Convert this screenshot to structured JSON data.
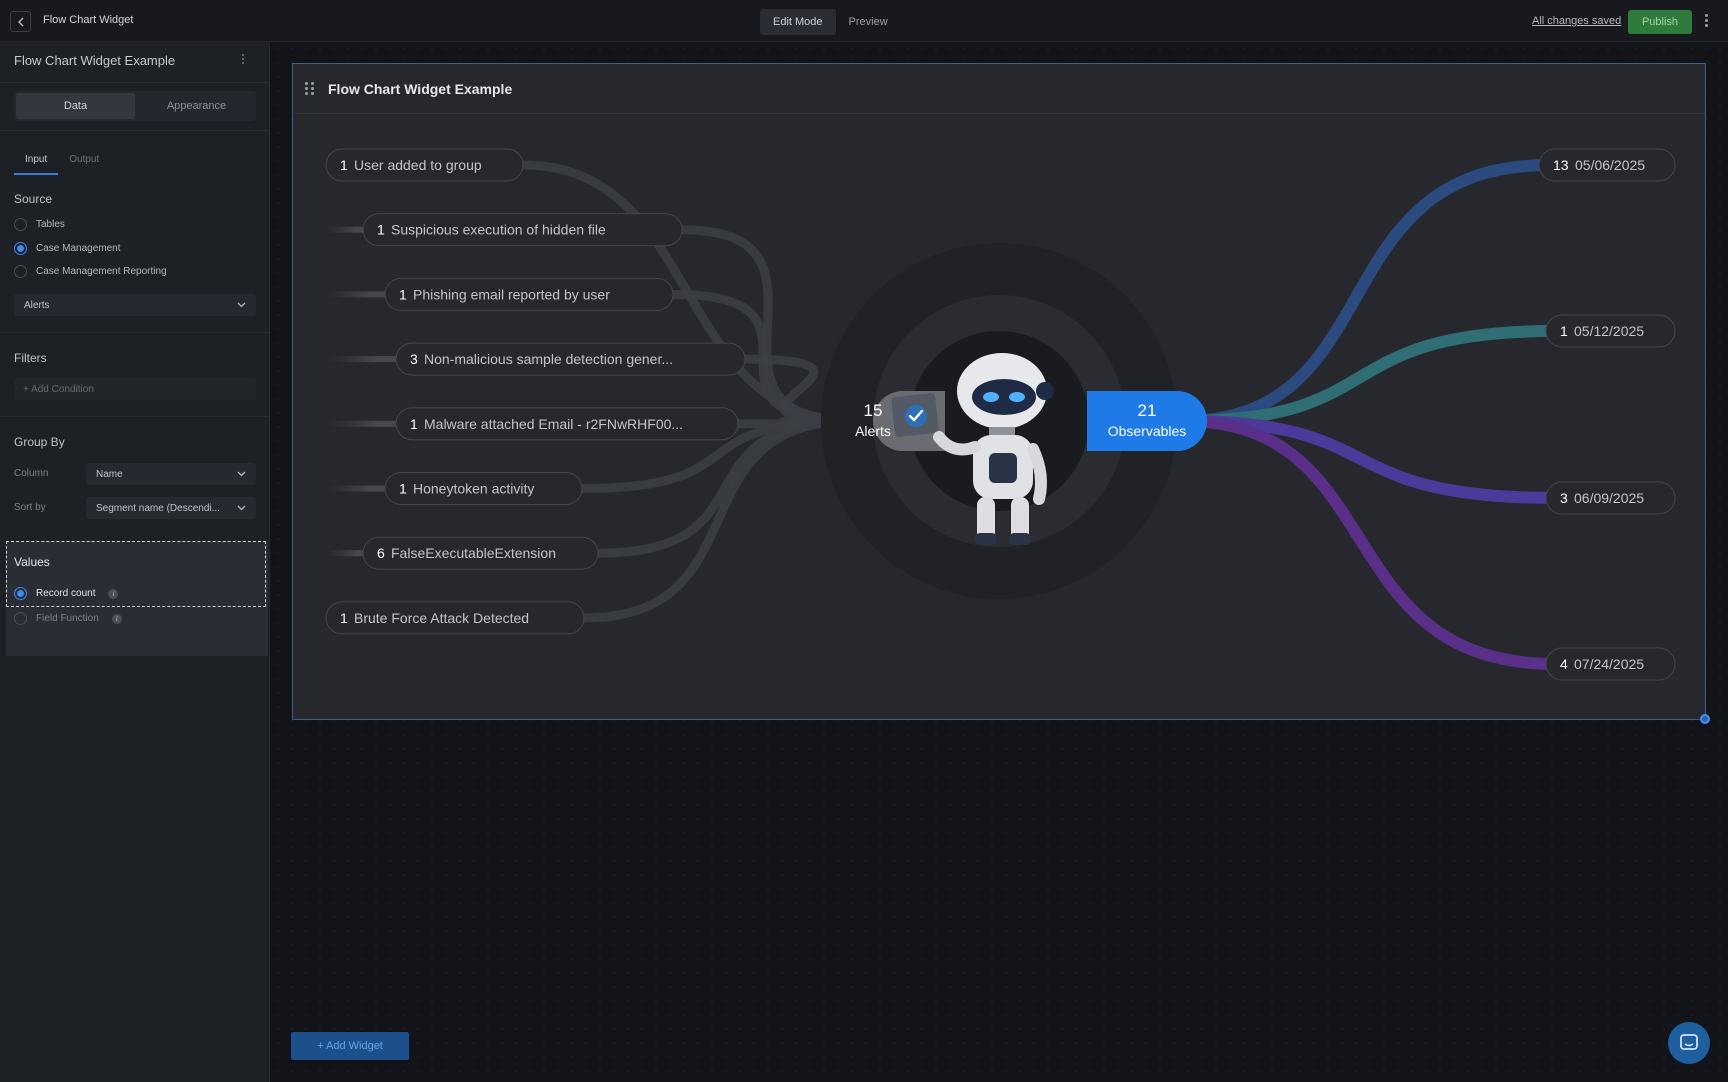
{
  "topbar": {
    "title": "Flow Chart Widget",
    "modes": [
      "Edit Mode",
      "Preview"
    ],
    "active_mode": "Edit Mode",
    "saved": "All changes saved",
    "publish": "Publish"
  },
  "sidebar": {
    "header": "Flow Chart Widget Example",
    "tabs": [
      "Data",
      "Appearance"
    ],
    "subtabs": [
      "Input",
      "Output"
    ],
    "source": {
      "title": "Source",
      "options": [
        "Tables",
        "Case Management",
        "Case Management Reporting"
      ],
      "selected": "Case Management",
      "dataset": "Alerts"
    },
    "filters": {
      "title": "Filters",
      "add": "+ Add Condition"
    },
    "group_by": {
      "title": "Group By",
      "column_label": "Column",
      "column_value": "Name",
      "sort_label": "Sort by",
      "sort_value": "Segment name (Descendi..."
    },
    "values": {
      "title": "Values",
      "options": [
        "Record count",
        "Field Function"
      ],
      "selected": "Record count"
    }
  },
  "widget": {
    "title": "Flow Chart Widget Example",
    "center_left": {
      "count": "15",
      "label": "Alerts"
    },
    "center_right": {
      "count": "21",
      "label": "Observables"
    },
    "inputs": [
      {
        "count": "1",
        "label": "User added to group"
      },
      {
        "count": "1",
        "label": "Suspicious execution of hidden file"
      },
      {
        "count": "1",
        "label": "Phishing email reported by user"
      },
      {
        "count": "3",
        "label": "Non-malicious sample detection gener..."
      },
      {
        "count": "1",
        "label": "Malware attached Email - r2FNwRHF00..."
      },
      {
        "count": "1",
        "label": "Honeytoken activity"
      },
      {
        "count": "6",
        "label": "FalseExecutableExtension"
      },
      {
        "count": "1",
        "label": "Brute Force Attack Detected"
      }
    ],
    "outputs": [
      {
        "count": "13",
        "label": "05/06/2025",
        "color": "#2b4a80"
      },
      {
        "count": "1",
        "label": "05/12/2025",
        "color": "#2f6e74"
      },
      {
        "count": "3",
        "label": "06/09/2025",
        "color": "#4b3a9a"
      },
      {
        "count": "4",
        "label": "07/24/2025",
        "color": "#5a2f8a"
      }
    ]
  },
  "add_widget": "+ Add Widget",
  "colors": {
    "accent": "#2f8cf0",
    "publish": "#2f7b3c",
    "observables": "#1e7ae6"
  }
}
